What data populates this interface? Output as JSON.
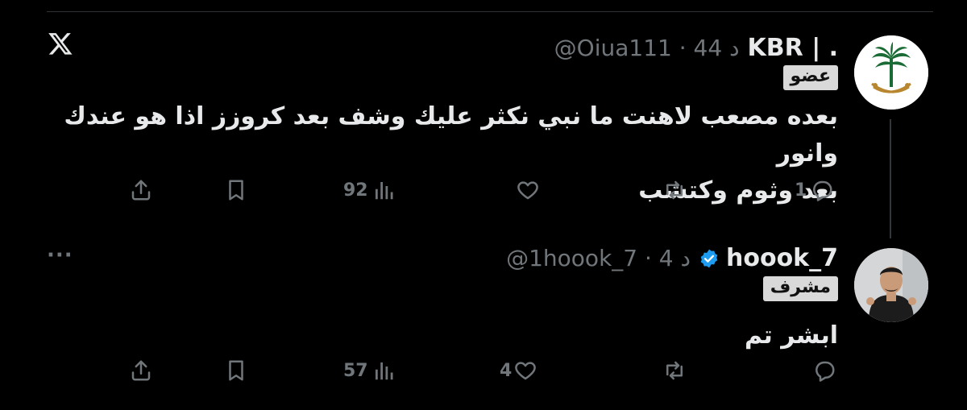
{
  "tweets": [
    {
      "display_name": "KBR | .",
      "meta": "@Oiua111 · 44 د",
      "badge": "عضو",
      "text_lines": [
        "بعده مصعب لاهنت ما نبي نكثر عليك وشف بعد كروزز اذا هو عندك وانور",
        "بعد وثوم وكتشب"
      ],
      "replies": "1",
      "retweets": "",
      "likes": "",
      "views": "92"
    },
    {
      "display_name": "hoook_7",
      "meta": "@1hoook_7 · 4 د",
      "badge": "مشرف",
      "text_lines": [
        "ابشر تم"
      ],
      "replies": "",
      "retweets": "",
      "likes": "4",
      "views": "57"
    }
  ],
  "icons": {
    "logo": "x-logo-icon",
    "verified": "verified-badge-icon",
    "reply": "reply-icon",
    "retweet": "retweet-icon",
    "like": "heart-icon",
    "views": "views-icon",
    "bookmark": "bookmark-icon",
    "share": "share-icon",
    "more": "more-icon"
  },
  "colors": {
    "background": "#000000",
    "text": "#e7e9ea",
    "muted": "#71767b",
    "verified": "#1d9bf0"
  }
}
